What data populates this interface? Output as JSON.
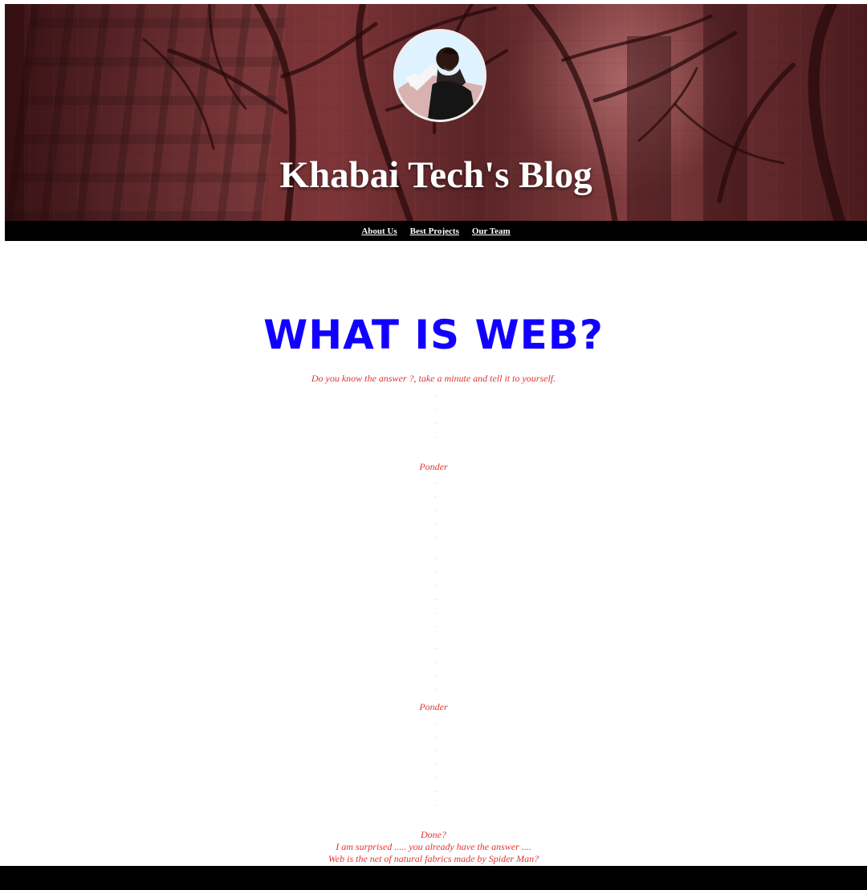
{
  "header": {
    "title": "Khabai Tech's Blog",
    "avatar_icon": "profile-photo-icon"
  },
  "nav": {
    "items": [
      {
        "label": "About Us"
      },
      {
        "label": "Best Projects"
      },
      {
        "label": "Our Team"
      }
    ]
  },
  "post": {
    "title": "WHAT IS WEB?",
    "lines": [
      {
        "text": "Do you know the answer ?, take a minute and tell it to yourself."
      },
      {
        "text": "Ponder"
      },
      {
        "text": "Ponder"
      },
      {
        "text": "Done?"
      },
      {
        "text": "I am surprised ..... you already have the answer ...."
      },
      {
        "text": "Web is the net of natural fabrics made by Spider Man?"
      }
    ],
    "dot_text": "."
  },
  "colors": {
    "title_blue": "#1100ff",
    "post_red": "#e33333",
    "banner_red": "#7b3437"
  }
}
